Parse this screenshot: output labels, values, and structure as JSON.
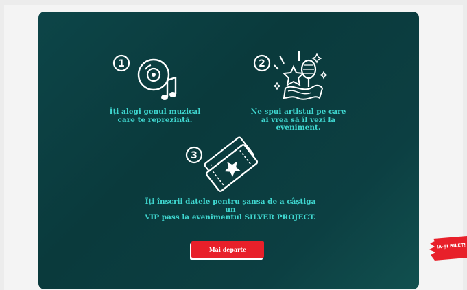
{
  "steps": [
    {
      "number": "1",
      "text": "Îți alegi genul muzical\ncare te reprezintă.",
      "icon": "music-cd-icon"
    },
    {
      "number": "2",
      "text": "Ne spui artistul pe care\nai vrea să îl vezi la\neveniment.",
      "icon": "microphone-star-icon"
    },
    {
      "number": "3",
      "text": "Îți înscrii datele pentru șansa de a câștiga un\nVIP pass la evenimentul SILVER PROJECT.",
      "icon": "ticket-icon"
    }
  ],
  "cta": {
    "label": "Mai departe"
  },
  "side_tab": {
    "label": "IA-ȚI BILET!"
  },
  "colors": {
    "panel": "#0b3c3e",
    "accent_text": "#3fd6cf",
    "button": "#e8202a"
  }
}
